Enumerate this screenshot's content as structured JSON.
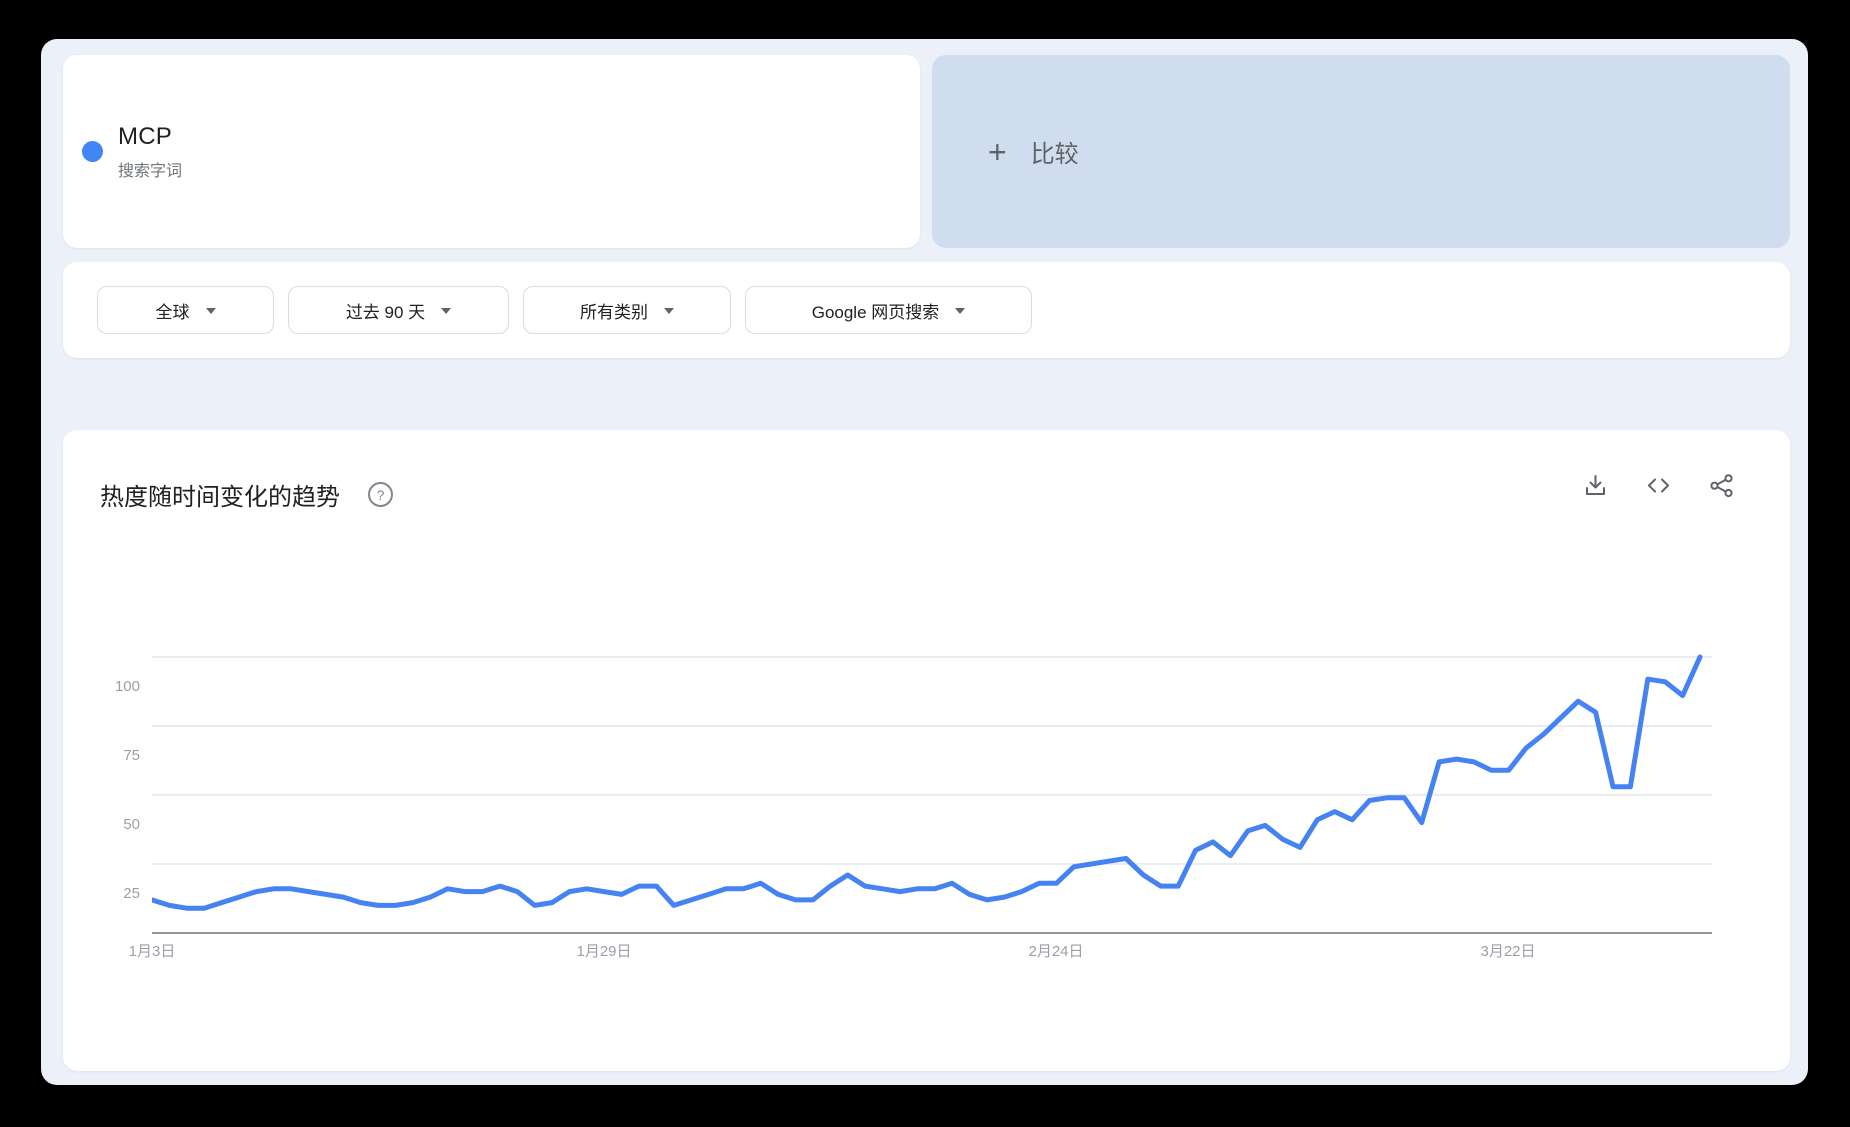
{
  "term_card": {
    "term": "MCP",
    "subtitle": "搜索字词",
    "dot_color": "#4285f4"
  },
  "compare_card": {
    "plus": "+",
    "label": "比较"
  },
  "filters": {
    "region": "全球",
    "time_range": "过去 90 天",
    "category": "所有类别",
    "search_type": "Google 网页搜索"
  },
  "trend_card": {
    "title": "热度随时间变化的趋势",
    "help_icon": "help-circle",
    "actions": [
      "download",
      "embed",
      "share"
    ]
  },
  "chart_data": {
    "type": "line",
    "title": "热度随时间变化的趋势",
    "x_tick_labels": [
      "1月3日",
      "1月29日",
      "2月24日",
      "3月22日"
    ],
    "x_tick_positions_days": [
      0,
      26,
      52,
      78
    ],
    "x_range_days": 90,
    "y_ticks": [
      25,
      50,
      75,
      100
    ],
    "ylim": [
      0,
      100
    ],
    "grid": "horizontal",
    "legend_position": "none",
    "series": [
      {
        "name": "MCP",
        "color": "#4582f2",
        "values": [
          12,
          10,
          9,
          9,
          11,
          13,
          15,
          16,
          16,
          15,
          14,
          13,
          11,
          10,
          10,
          11,
          13,
          16,
          15,
          15,
          17,
          15,
          10,
          11,
          15,
          16,
          15,
          14,
          17,
          17,
          10,
          12,
          14,
          16,
          16,
          18,
          14,
          12,
          12,
          17,
          21,
          17,
          16,
          15,
          16,
          16,
          18,
          14,
          12,
          13,
          15,
          18,
          18,
          24,
          25,
          26,
          27,
          21,
          17,
          17,
          30,
          33,
          28,
          37,
          39,
          34,
          31,
          41,
          44,
          41,
          48,
          49,
          49,
          40,
          62,
          63,
          62,
          59,
          59,
          67,
          72,
          78,
          84,
          80,
          53,
          53,
          92,
          91,
          86,
          100
        ]
      }
    ]
  }
}
